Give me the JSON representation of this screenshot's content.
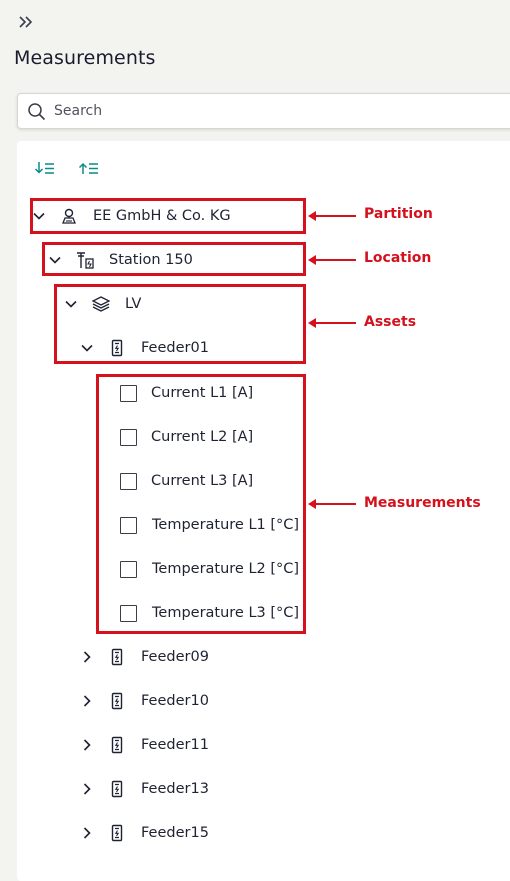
{
  "header": {
    "title": "Measurements",
    "expand_icon": "double-chevron-right-icon"
  },
  "search": {
    "placeholder": "Search",
    "icon": "search-icon"
  },
  "toolbar": {
    "expand_all_icon": "expand-all-icon",
    "collapse_all_icon": "collapse-all-icon"
  },
  "tree": {
    "partition": {
      "label": "EE GmbH & Co. KG",
      "icon": "partition-icon",
      "expanded": true
    },
    "location": {
      "label": "Station 150",
      "icon": "substation-icon",
      "expanded": true
    },
    "asset_group": {
      "label": "LV",
      "icon": "layers-icon",
      "expanded": true
    },
    "feeder_open": {
      "label": "Feeder01",
      "icon": "feeder-icon",
      "expanded": true
    },
    "measurements": [
      {
        "label": "Current L1 [A]",
        "checked": false
      },
      {
        "label": "Current L2 [A]",
        "checked": false
      },
      {
        "label": "Current L3 [A]",
        "checked": false
      },
      {
        "label": "Temperature L1 [°C]",
        "checked": false
      },
      {
        "label": "Temperature L2 [°C]",
        "checked": false
      },
      {
        "label": "Temperature L3 [°C]",
        "checked": false
      }
    ],
    "feeders_collapsed": [
      {
        "label": "Feeder09",
        "expanded": false
      },
      {
        "label": "Feeder10",
        "expanded": false
      },
      {
        "label": "Feeder11",
        "expanded": false
      },
      {
        "label": "Feeder13",
        "expanded": false
      },
      {
        "label": "Feeder15",
        "expanded": false
      }
    ]
  },
  "annotations": {
    "partition": "Partition",
    "location": "Location",
    "assets": "Assets",
    "measurements": "Measurements",
    "color": "#d4121e"
  }
}
